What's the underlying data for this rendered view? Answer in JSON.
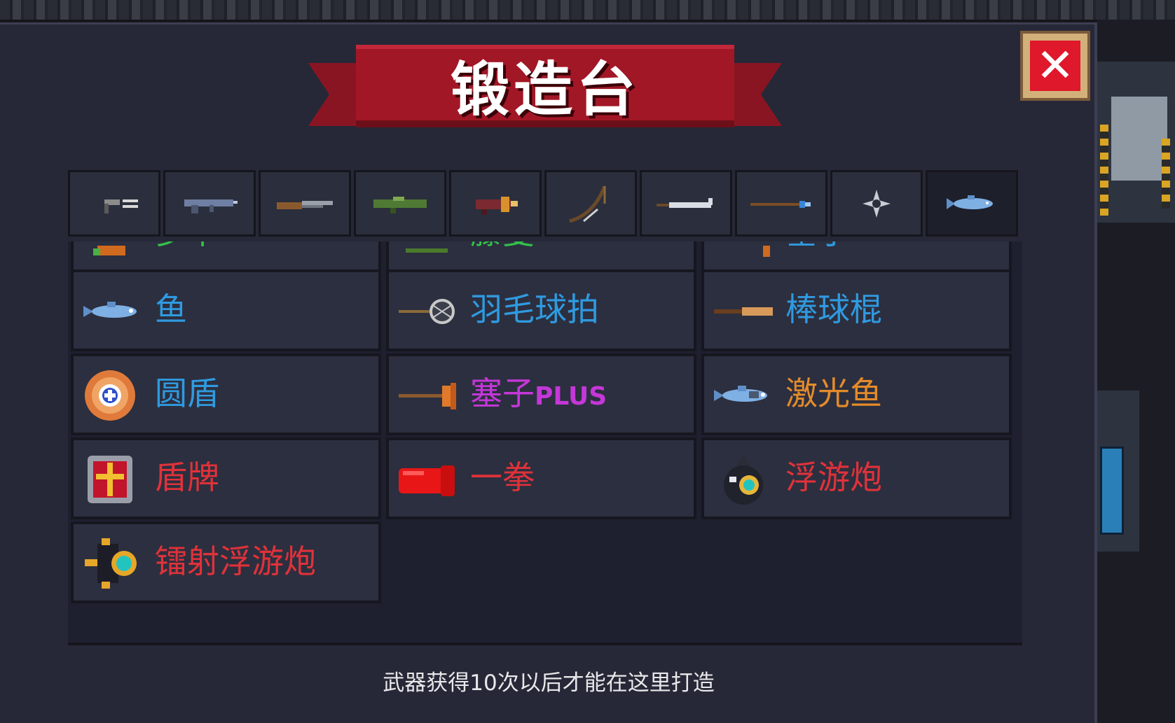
{
  "title": "锻造台",
  "close_label": "✕",
  "tabs": [
    {
      "name": "pistol-icon",
      "active": false
    },
    {
      "name": "rifle-icon",
      "active": false
    },
    {
      "name": "shotgun-icon",
      "active": false
    },
    {
      "name": "rocket-launcher-icon",
      "active": false
    },
    {
      "name": "laser-gun-icon",
      "active": false
    },
    {
      "name": "bow-icon",
      "active": false
    },
    {
      "name": "sword-icon",
      "active": false
    },
    {
      "name": "spear-icon",
      "active": false
    },
    {
      "name": "shuriken-icon",
      "active": false
    },
    {
      "name": "fish-icon",
      "active": true
    }
  ],
  "partial_row": [
    {
      "label": "梦下",
      "color": "#33c24a",
      "icon": "carrot-icon"
    },
    {
      "label": "藤曼",
      "color": "#33c24a",
      "icon": "vine-icon"
    },
    {
      "label": "塞子",
      "color": "#2f9ae0",
      "icon": "plunger-icon"
    }
  ],
  "items": [
    {
      "label": "鱼",
      "plus": "",
      "color": "#2f9ae0",
      "icon": "fish-icon"
    },
    {
      "label": "羽毛球拍",
      "plus": "",
      "color": "#2f9ae0",
      "icon": "badminton-racket-icon"
    },
    {
      "label": "棒球棍",
      "plus": "",
      "color": "#2f9ae0",
      "icon": "baseball-bat-icon"
    },
    {
      "label": "圆盾",
      "plus": "",
      "color": "#2f9ae0",
      "icon": "round-shield-icon"
    },
    {
      "label": "塞子",
      "plus": "PLUS",
      "color": "#c437d8",
      "icon": "plunger-icon"
    },
    {
      "label": "激光鱼",
      "plus": "",
      "color": "#e48b2a",
      "icon": "laser-fish-icon"
    },
    {
      "label": "盾牌",
      "plus": "",
      "color": "#e0323a",
      "icon": "shield-icon"
    },
    {
      "label": "一拳",
      "plus": "",
      "color": "#e0323a",
      "icon": "fist-icon"
    },
    {
      "label": "浮游炮",
      "plus": "",
      "color": "#e0323a",
      "icon": "floating-cannon-icon"
    },
    {
      "label": "镭射浮游炮",
      "plus": "",
      "color": "#e0323a",
      "icon": "laser-floating-cannon-icon"
    }
  ],
  "footer_note": "武器获得10次以后才能在这里打造"
}
